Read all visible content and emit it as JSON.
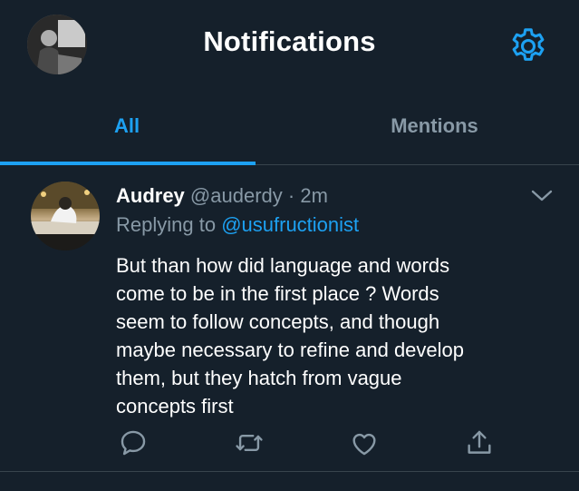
{
  "header": {
    "title": "Notifications",
    "avatar_icon": "user-avatar",
    "settings_icon": "gear-icon"
  },
  "tabs": [
    {
      "label": "All",
      "active": true
    },
    {
      "label": "Mentions",
      "active": false
    }
  ],
  "tweet": {
    "name": "Audrey",
    "handle": "@auderdy",
    "separator": "·",
    "time": "2m",
    "replying_prefix": "Replying to",
    "replying_to": "@usufructionist",
    "text_lines": [
      "But than how did language and words",
      "come to be in the first place ? Words",
      "seem to follow concepts, and though",
      "maybe necessary to refine and develop",
      "them, but they hatch from vague",
      "concepts first"
    ],
    "actions": [
      "reply-icon",
      "retweet-icon",
      "like-icon",
      "share-icon"
    ]
  },
  "colors": {
    "background": "#15202b",
    "accent": "#1da1f2",
    "secondary_text": "#8899a6",
    "divider": "#38444d"
  }
}
